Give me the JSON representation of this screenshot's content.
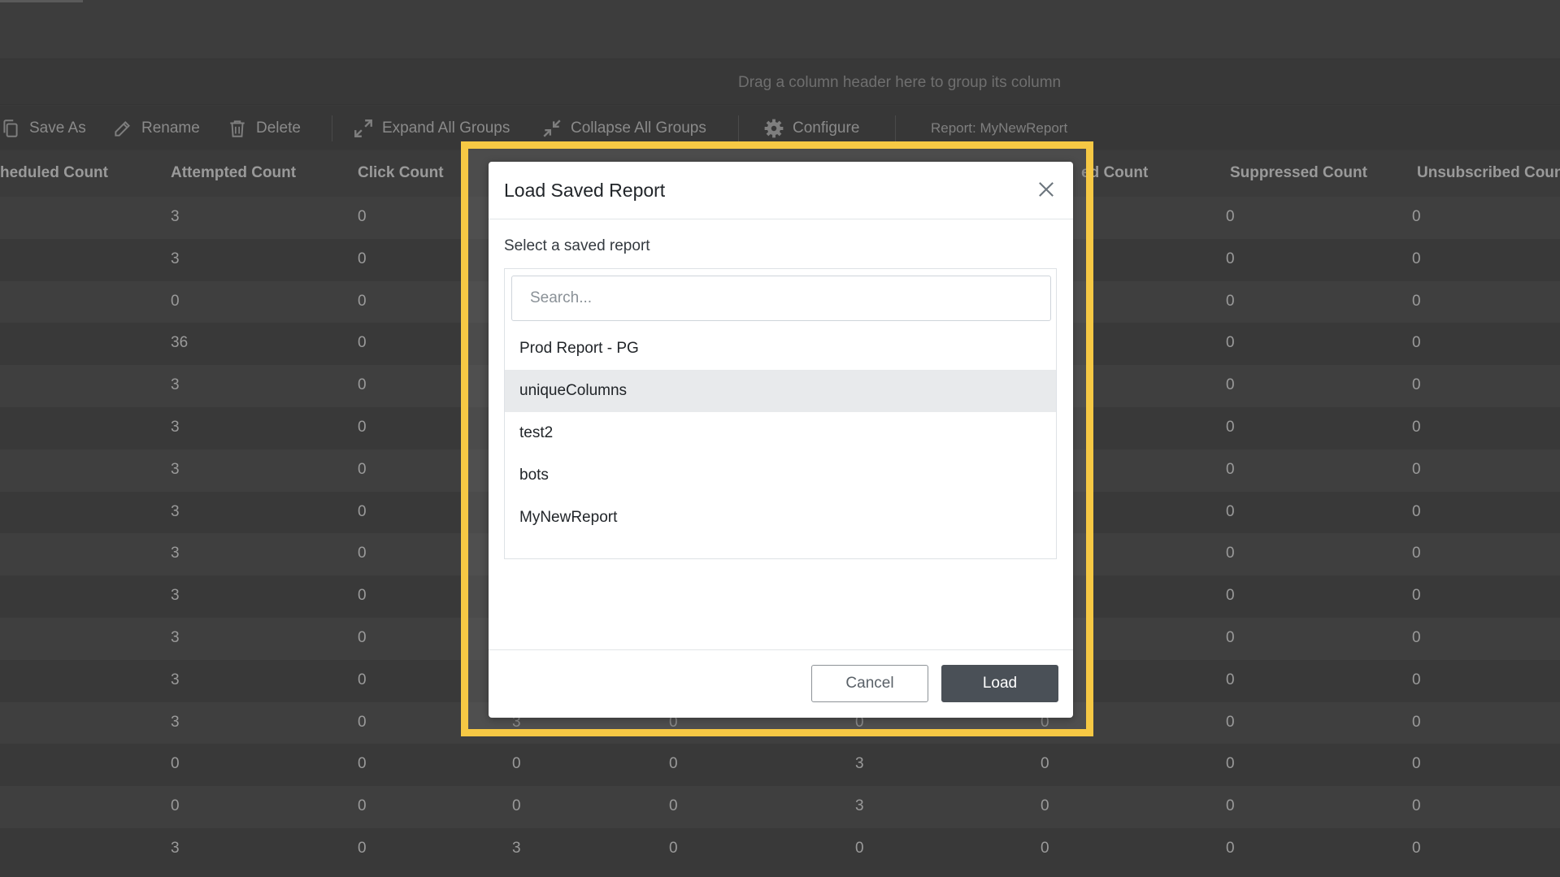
{
  "group_panel": {
    "hint": "Drag a column header here to group its column"
  },
  "toolbar": {
    "save_as": "Save As",
    "rename": "Rename",
    "delete": "Delete",
    "expand_all": "Expand All Groups",
    "collapse_all": "Collapse All Groups",
    "configure": "Configure",
    "report_label": "Report: MyNewReport"
  },
  "columns": {
    "c1": "heduled Count",
    "c2": "Attempted Count",
    "c3": "Click Count",
    "c6": "ed Count",
    "c7": "Suppressed Count",
    "c8": "Unsubscribed Coun"
  },
  "rows": [
    [
      "3",
      "0",
      "",
      "",
      "",
      "",
      "0",
      "0"
    ],
    [
      "3",
      "0",
      "",
      "",
      "",
      "",
      "0",
      "0"
    ],
    [
      "0",
      "0",
      "",
      "",
      "",
      "",
      "0",
      "0"
    ],
    [
      "36",
      "0",
      "",
      "",
      "",
      "",
      "0",
      "0"
    ],
    [
      "3",
      "0",
      "",
      "",
      "",
      "",
      "0",
      "0"
    ],
    [
      "3",
      "0",
      "",
      "",
      "",
      "",
      "0",
      "0"
    ],
    [
      "3",
      "0",
      "",
      "",
      "",
      "",
      "0",
      "0"
    ],
    [
      "3",
      "0",
      "",
      "",
      "",
      "",
      "0",
      "0"
    ],
    [
      "3",
      "0",
      "",
      "",
      "",
      "",
      "0",
      "0"
    ],
    [
      "3",
      "0",
      "",
      "",
      "",
      "",
      "0",
      "0"
    ],
    [
      "3",
      "0",
      "",
      "",
      "",
      "",
      "0",
      "0"
    ],
    [
      "3",
      "0",
      "",
      "",
      "",
      "",
      "0",
      "0"
    ],
    [
      "3",
      "0",
      "3",
      "0",
      "0",
      "0",
      "0",
      "0"
    ],
    [
      "0",
      "0",
      "0",
      "0",
      "3",
      "0",
      "0",
      "0"
    ],
    [
      "0",
      "0",
      "0",
      "0",
      "3",
      "0",
      "0",
      "0"
    ],
    [
      "3",
      "0",
      "3",
      "0",
      "0",
      "0",
      "0",
      "0"
    ]
  ],
  "modal": {
    "title": "Load Saved Report",
    "select_label": "Select a saved report",
    "search_placeholder": "Search...",
    "options": [
      "Prod Report - PG",
      "uniqueColumns",
      "test2",
      "bots",
      "MyNewReport"
    ],
    "selected_option": "uniqueColumns",
    "cancel_label": "Cancel",
    "load_label": "Load"
  },
  "colors": {
    "highlight_frame": "#f6c844",
    "primary_button": "#4a5057",
    "selected_row": "#e8eaec"
  },
  "icons": {
    "save_as": "copy-icon",
    "rename": "edit-icon",
    "delete": "trash-icon",
    "expand": "expand-icon",
    "collapse": "collapse-icon",
    "configure": "gear-icon",
    "close": "close-icon"
  }
}
